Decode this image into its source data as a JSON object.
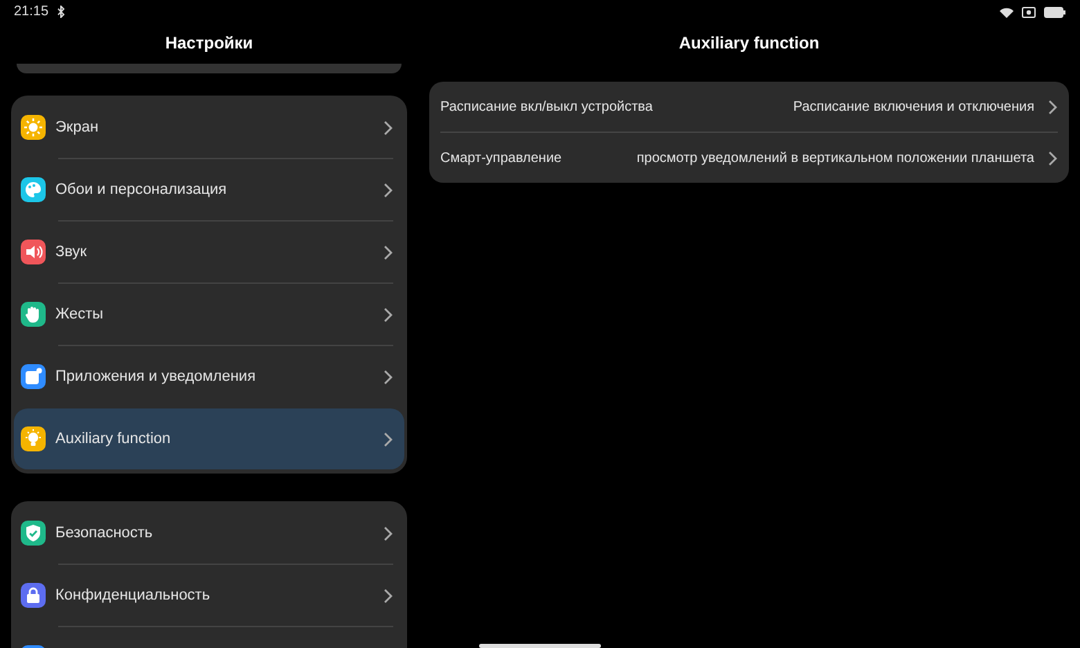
{
  "status_bar": {
    "time": "21:15"
  },
  "settings": {
    "title": "Настройки",
    "groups": [
      [
        {
          "label": "Экран",
          "kind": "display",
          "color": "#f5b400",
          "selected": false
        },
        {
          "label": "Обои и персонализация",
          "kind": "palette",
          "color": "#1cc6e8",
          "selected": false
        },
        {
          "label": "Звук",
          "kind": "sound",
          "color": "#f0565a",
          "selected": false
        },
        {
          "label": "Жесты",
          "kind": "hand",
          "color": "#1fb98a",
          "selected": false
        },
        {
          "label": "Приложения и уведомления",
          "kind": "apps",
          "color": "#2f8cff",
          "selected": false
        },
        {
          "label": "Auxiliary function",
          "kind": "bulb",
          "color": "#f5b400",
          "selected": true
        }
      ],
      [
        {
          "label": "Безопасность",
          "kind": "shield",
          "color": "#1fb98a",
          "selected": false
        },
        {
          "label": "Конфиденциальность",
          "kind": "lock",
          "color": "#5d6df0",
          "selected": false
        },
        {
          "kind": "partial",
          "color": "#2f8cff",
          "selected": false
        }
      ]
    ]
  },
  "detail": {
    "title": "Auxiliary function",
    "rows": [
      {
        "label": "Расписание вкл/выкл устройства",
        "value": "Расписание включения и отключения"
      },
      {
        "label": "Смарт-управление",
        "value": "просмотр уведомлений в вертикальном положении планшета"
      }
    ]
  }
}
